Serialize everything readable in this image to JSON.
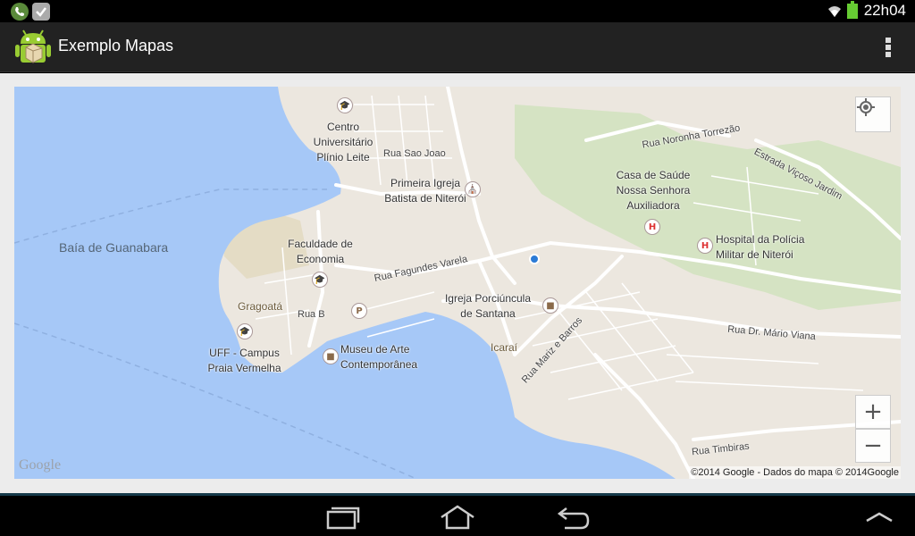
{
  "status_bar": {
    "time": "22h04",
    "icons": [
      "phone-notification-icon",
      "check-notification-icon",
      "wifi-icon",
      "battery-icon"
    ]
  },
  "action_bar": {
    "title": "Exemplo Mapas",
    "icon": "android-app-icon",
    "overflow_icon": "overflow-menu-icon"
  },
  "map": {
    "water_labels": [
      "Baía de Guanabara"
    ],
    "places": [
      "Centro Universitário Plínio Leite",
      "Primeira Igreja Batista de Niterói",
      "Casa de Saúde Nossa Senhora Auxiliadora",
      "Hospital da Polícia Militar de Niterói",
      "Faculdade de Economia",
      "Igreja Porciúncula de Santana",
      "Museu de Arte Contemporânea",
      "UFF - Campus Praia Vermelha"
    ],
    "streets": [
      "Rua Noronha Torrezão",
      "Rua Sao Joao",
      "Estrada Viçoso Jardim",
      "Rua Fagundes Varela",
      "Rua B",
      "Rua Dr. Mário Viana",
      "Rua Mariz e Barros",
      "Rua Timbiras"
    ],
    "districts": [
      "Gragoatá",
      "Icaraí"
    ],
    "zoom_in": "+",
    "zoom_out": "−",
    "copyright": "©2014 Google - Dados do mapa © 2014Google",
    "logo": "Google"
  },
  "nav_bar": {
    "buttons": [
      "recent-apps-icon",
      "home-icon",
      "back-icon",
      "up-chevron-icon"
    ]
  },
  "colors": {
    "water": "#a6c8f7",
    "land": "#ece7df",
    "park": "#cfe0bf",
    "road": "#ffffff",
    "action_bar": "#222222"
  }
}
